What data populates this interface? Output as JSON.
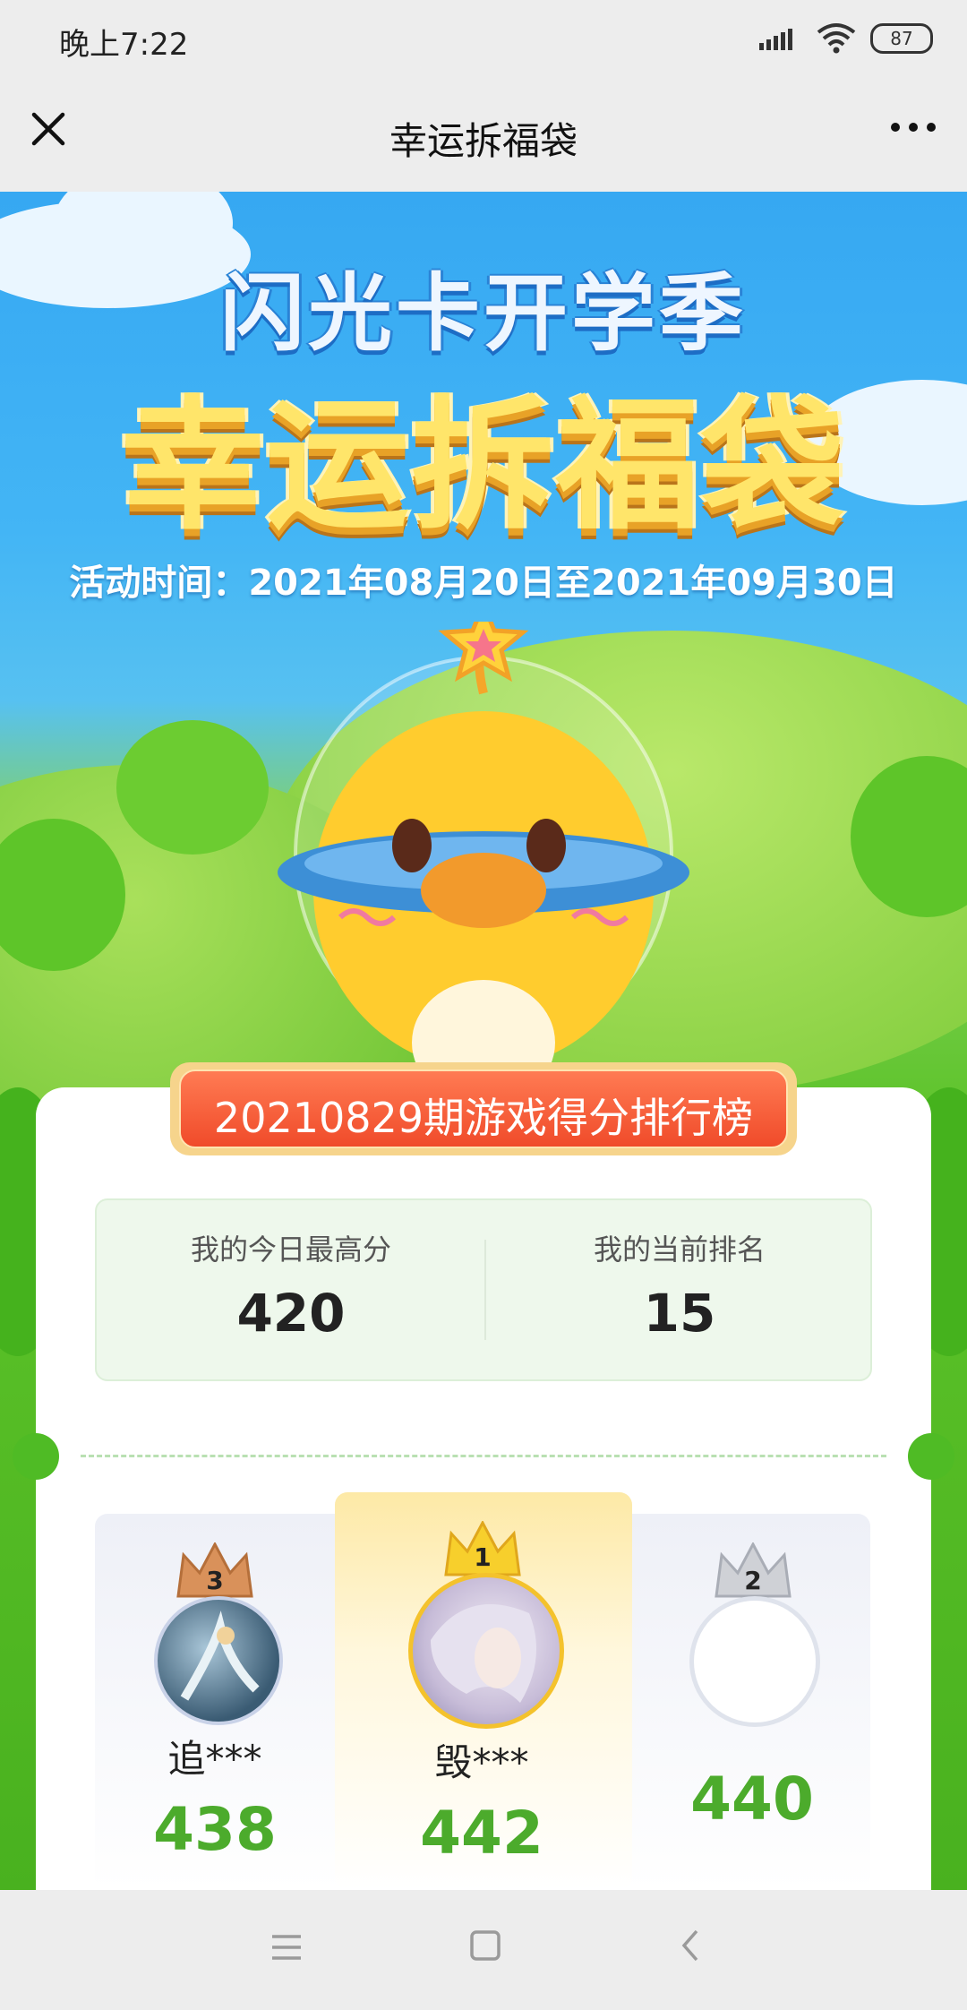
{
  "status": {
    "time": "晚上7:22",
    "battery": "87"
  },
  "nav": {
    "title": "幸运拆福袋"
  },
  "banner": {
    "subtitle": "闪光卡开学季",
    "headline": "幸运拆福袋",
    "dates": "活动时间：2021年08月20日至2021年09月30日"
  },
  "leaderboard": {
    "title": "20210829期游戏得分排行榜",
    "my_best_label": "我的今日最高分",
    "my_best": "420",
    "my_rank_label": "我的当前排名",
    "my_rank": "15",
    "players": [
      {
        "rank": "3",
        "name": "追***",
        "score": "438"
      },
      {
        "rank": "1",
        "name": "毁***",
        "score": "442"
      },
      {
        "rank": "2",
        "name": "",
        "score": "440"
      }
    ]
  },
  "colors": {
    "accent_green": "#4cab2c",
    "ribbon_red": "#f04b2a",
    "gold": "#f2c12e"
  },
  "icons": [
    "close-icon",
    "more-icon",
    "signal-icon",
    "wifi-icon",
    "battery-icon",
    "menu-icon",
    "home-icon",
    "back-icon"
  ]
}
